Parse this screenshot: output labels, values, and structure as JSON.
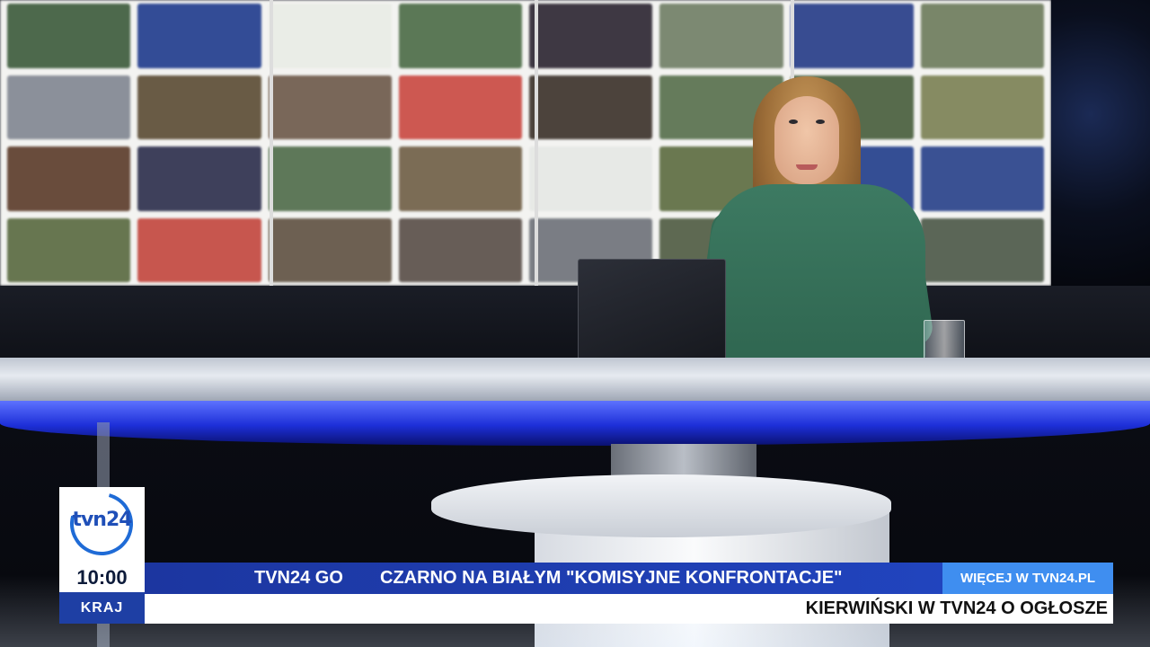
{
  "broadcast": {
    "channel_logo": "tvn24",
    "time": "10:00",
    "section": "KRAJ",
    "brand_label": "TVN24 GO",
    "show_title": "CZARNO NA BIAŁYM  \"KOMISYJNE KONFRONTACJE\"",
    "more_link": "WIĘCEJ W TVN24.PL",
    "ticker": "KIERWIŃSKI W TVN24 O OGŁOSZE"
  },
  "colors": {
    "bar_blue": "#2247c4",
    "more_blue": "#3f8ef0",
    "section_blue": "#1e3fa4",
    "desk_glow": "#1d2fd8",
    "sweater_green": "#3d7a62"
  }
}
